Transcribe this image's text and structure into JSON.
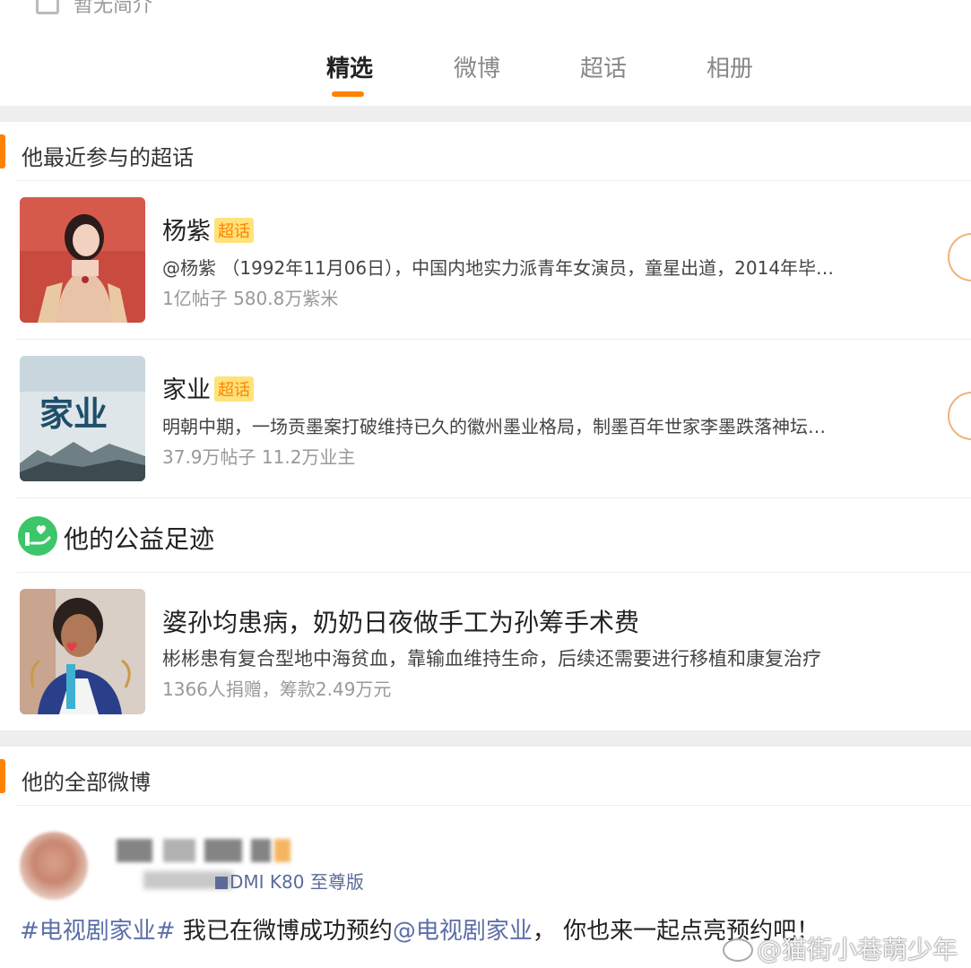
{
  "profile": {
    "intro_placeholder": "暂无简介"
  },
  "tabs": [
    {
      "label": "精选",
      "active": true
    },
    {
      "label": "微博",
      "active": false
    },
    {
      "label": "超话",
      "active": false
    },
    {
      "label": "相册",
      "active": false
    }
  ],
  "super_topics_section": {
    "title": "他最近参与的超话",
    "badge": "超话",
    "items": [
      {
        "name": "杨紫",
        "desc": "@杨紫 （1992年11月06日），中国内地实力派青年女演员，童星出道，2014年毕…",
        "stats": "1亿帖子 580.8万紫米"
      },
      {
        "name": "家业",
        "cover_text": "家业",
        "desc": "明朝中期，一场贡墨案打破维持已久的徽州墨业格局，制墨百年世家李墨跌落神坛…",
        "stats": "37.9万帖子 11.2万业主"
      }
    ]
  },
  "charity_section": {
    "title": "他的公益足迹",
    "icon": "charity-heart-hand-icon",
    "item": {
      "title": "婆孙均患病，奶奶日夜做手工为孙筹手术费",
      "desc": "彬彬患有复合型地中海贫血，靠输血维持生命，后续还需要进行移植和康复治疗",
      "stats": "1366人捐赠，筹款2.49万元"
    }
  },
  "all_weibo_section": {
    "title": "他的全部微博",
    "post": {
      "source": "DMI K80 至尊版",
      "hashtag": "#电视剧家业#",
      "text_1": " 我已在微博成功预约",
      "mention": "@电视剧家业",
      "text_2": "， 你也来一起点亮预约吧！"
    }
  },
  "watermark": {
    "text": "@猫街小巷萌少年"
  },
  "colors": {
    "accent": "#ff8200",
    "link": "#5b6ea8",
    "charity_green": "#3cc569",
    "badge_bg": "#ffe27a"
  }
}
